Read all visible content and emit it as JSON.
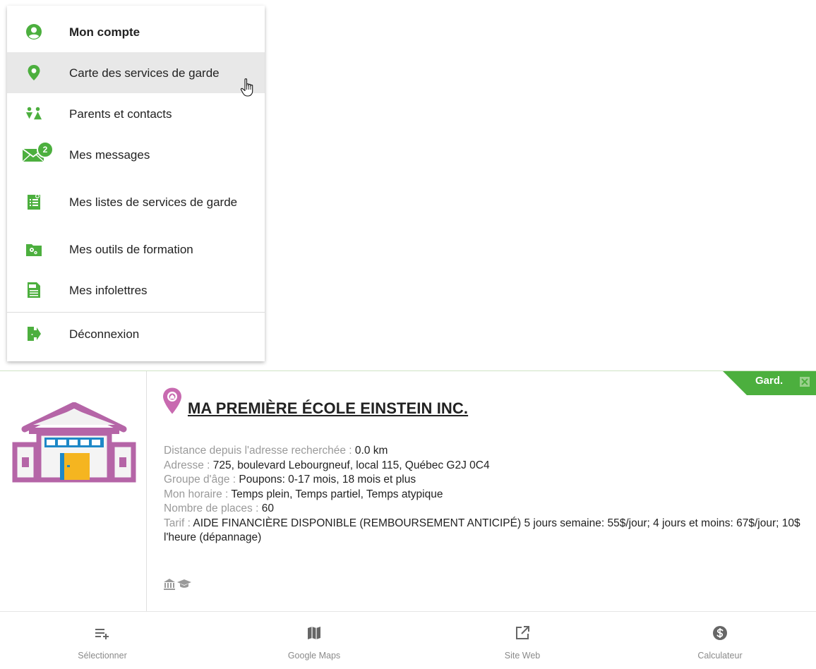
{
  "menu": {
    "items": [
      {
        "label": "Mon compte",
        "icon": "account-circle-icon"
      },
      {
        "label": "Carte des services de garde",
        "icon": "map-pin-icon"
      },
      {
        "label": "Parents et contacts",
        "icon": "parents-icon"
      },
      {
        "label": "Mes messages",
        "icon": "envelope-icon",
        "badge": "2"
      },
      {
        "label": "Mes listes de services de garde",
        "icon": "list-icon"
      },
      {
        "label": "Mes outils de formation",
        "icon": "training-folder-icon"
      },
      {
        "label": "Mes infolettres",
        "icon": "newsletter-icon"
      },
      {
        "label": "Déconnexion",
        "icon": "logout-icon"
      }
    ],
    "hovered_index": 1
  },
  "result": {
    "ribbon_label": "Gard.",
    "title": "MA PREMIÈRE ÉCOLE EINSTEIN INC.",
    "fields": [
      {
        "key": "Distance depuis l'adresse recherchée : ",
        "value": "0.0 km"
      },
      {
        "key": "Adresse : ",
        "value": "725, boulevard Lebourgneuf, local 115, Québec G2J 0C4"
      },
      {
        "key": "Groupe d'âge : ",
        "value": "Poupons: 0-17 mois, 18 mois et plus"
      },
      {
        "key": "Mon horaire : ",
        "value": "Temps plein, Temps partiel, Temps atypique"
      },
      {
        "key": "Nombre de places : ",
        "value": "60"
      },
      {
        "key": "Tarif : ",
        "value": "AIDE FINANCIÈRE DISPONIBLE (REMBOURSEMENT ANTICIPÉ) 5 jours semaine: 55$/jour; 4 jours et moins: 67$/jour; 10$ l'heure (dépannage)"
      }
    ]
  },
  "actions": [
    {
      "label": "Sélectionner",
      "icon": "select-add-icon"
    },
    {
      "label": "Google Maps",
      "icon": "map-icon"
    },
    {
      "label": "Site Web",
      "icon": "external-link-icon"
    },
    {
      "label": "Calculateur",
      "icon": "dollar-icon"
    }
  ],
  "colors": {
    "accent_green": "#4caf3e",
    "pin_pink": "#c86ab0",
    "building_purple": "#b565a7",
    "building_blue": "#1e88c7",
    "door_orange": "#f5b520"
  }
}
